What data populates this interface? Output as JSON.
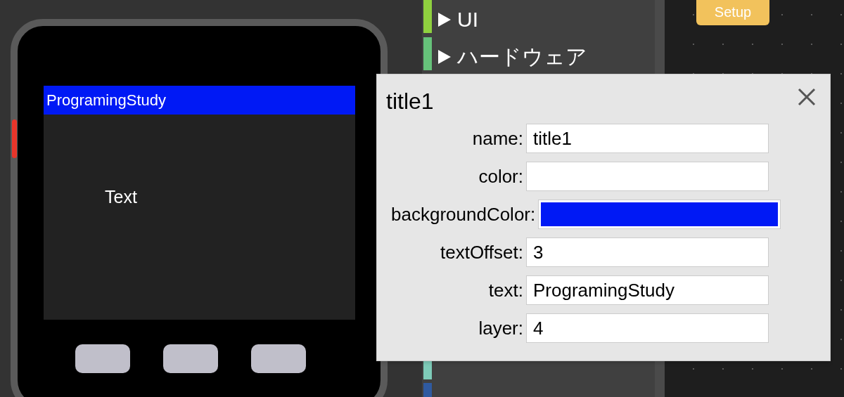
{
  "device": {
    "title_bar": {
      "text": "ProgramingStudy",
      "color": "#0019f5"
    },
    "label": "Text"
  },
  "toolbox": {
    "top_categories": [
      {
        "kind": "folder",
        "label": "UI",
        "color": "#8fd13f"
      },
      {
        "kind": "folder",
        "label": "ハードウェア",
        "color": "#66c27a"
      }
    ],
    "bottom_categories": [
      {
        "color": "#7ecbb8"
      },
      {
        "color": "#2f5aa0"
      }
    ]
  },
  "workspace": {
    "block": "Setup"
  },
  "dialog": {
    "title": "title1",
    "fields": [
      {
        "kind": "text",
        "label": "name:",
        "value": "title1"
      },
      {
        "kind": "color",
        "label": "color:",
        "color": "#ffffff"
      },
      {
        "kind": "color",
        "label": "backgroundColor:",
        "color": "#0019f5"
      },
      {
        "kind": "text",
        "label": "textOffset:",
        "value": "3"
      },
      {
        "kind": "text",
        "label": "text:",
        "value": "ProgramingStudy"
      },
      {
        "kind": "text",
        "label": "layer:",
        "value": "4"
      }
    ]
  }
}
